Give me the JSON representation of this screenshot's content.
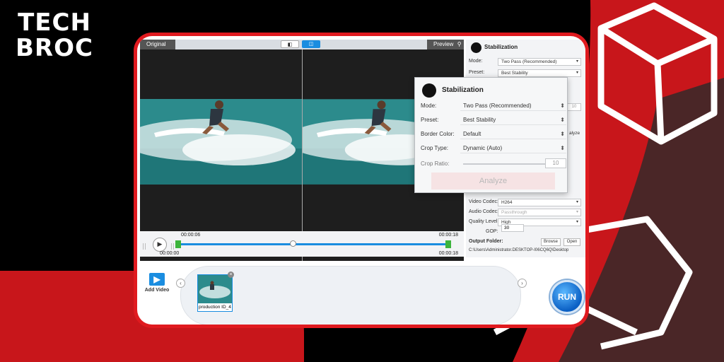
{
  "brand": {
    "logo_line1": "TECH",
    "logo_line2": "BROC",
    "red": "#e01a1f",
    "accent_blue": "#1a8de0"
  },
  "preview": {
    "original_label": "Original",
    "preview_label": "Preview",
    "search_icon": "search-icon",
    "view_toggle_icons": [
      "split-view-icon",
      "side-by-side-icon"
    ]
  },
  "timeline": {
    "current_time": "00:00:06",
    "start_time": "00:00:00",
    "end_time_top": "00:00:18",
    "end_time_bottom": "00:00:18",
    "progress": 0.42
  },
  "stabilization_panel": {
    "title": "Stabilization",
    "mode_label": "Mode:",
    "mode_value": "Two Pass (Recommended)",
    "preset_label": "Preset:",
    "preset_value": "Best Stability",
    "extra_frag_1": "10",
    "extra_frag_2": "alyze"
  },
  "popup": {
    "title": "Stabilization",
    "mode_label": "Mode:",
    "mode_value": "Two Pass (Recommended)",
    "preset_label": "Preset:",
    "preset_value": "Best Stability",
    "border_label": "Border Color:",
    "border_value": "Default",
    "crop_type_label": "Crop Type:",
    "crop_type_value": "Dynamic (Auto)",
    "crop_ratio_label": "Crop Ratio:",
    "crop_ratio_value": "10",
    "analyze_label": "Analyze"
  },
  "output": {
    "video_codec_label": "Video Codec:",
    "video_codec_value": "H264",
    "audio_codec_label": "Audio Codec:",
    "audio_codec_value": "Passthrough",
    "quality_label": "Quality Level:",
    "quality_value": "High",
    "gop_label": "GOP:",
    "gop_value": "30",
    "folder_label": "Output Folder:",
    "browse_label": "Browse",
    "open_label": "Open",
    "folder_path": "C:\\Users\\Administrator.DESKTOP-I06CQ6Q\\Desktop"
  },
  "bottom": {
    "add_video_label": "Add Video",
    "clip_name": "production ID_4",
    "run_label": "RUN"
  }
}
